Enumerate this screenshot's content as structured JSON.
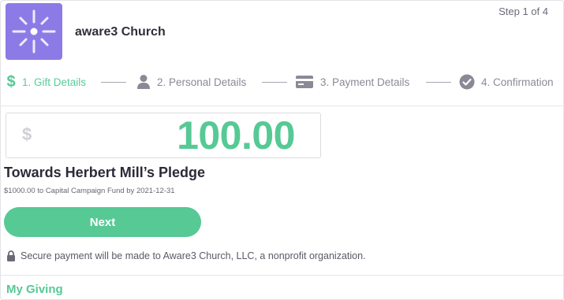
{
  "header": {
    "church_name": "aware3 Church",
    "step_count": "Step 1 of 4",
    "logo_icon": "sparkle-logo-icon"
  },
  "steps": [
    {
      "label": "1. Gift Details",
      "icon": "dollar-icon",
      "active": true
    },
    {
      "label": "2. Personal Details",
      "icon": "person-icon",
      "active": false
    },
    {
      "label": "3. Payment Details",
      "icon": "credit-card-icon",
      "active": false
    },
    {
      "label": "4. Confirmation",
      "icon": "check-circle-icon",
      "active": false
    }
  ],
  "amount": {
    "currency_symbol": "$",
    "value": "100.00"
  },
  "pledge": {
    "title": "Towards Herbert Mill’s Pledge",
    "subtitle": "$1000.00 to Capital Campaign Fund by 2021-12-31"
  },
  "actions": {
    "next_label": "Next"
  },
  "secure_note": {
    "text": "Secure payment will be made to Aware3 Church, LLC, a nonprofit organization.",
    "icon": "lock-icon"
  },
  "footer": {
    "my_giving_label": "My Giving"
  },
  "colors": {
    "accent": "#56c995",
    "logo_bg": "#8c7be6",
    "muted": "#8a8a96"
  }
}
